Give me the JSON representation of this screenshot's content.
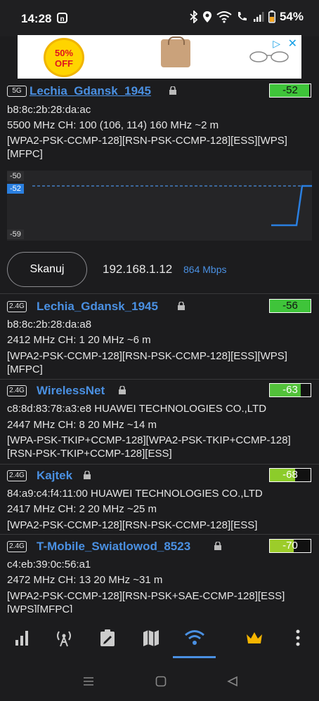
{
  "status_bar": {
    "time": "14:28",
    "battery": "54%"
  },
  "networks": [
    {
      "band": "5G",
      "ssid": "Lechia_Gdansk_1945",
      "signal": "-52",
      "signal_level": 0.96,
      "mac": "b8:8c:2b:28:da:ac",
      "details": "5500 MHz   CH: 100 (106, 114)   160 MHz   ~2 m",
      "security_1": "[WPA2-PSK-CCMP-128][RSN-PSK-CCMP-128][ESS][WPS]",
      "security_2": "[MFPC]"
    },
    {
      "band": "2.4G",
      "ssid": "Lechia_Gdansk_1945",
      "signal": "-56",
      "signal_level": 0.9,
      "mac": "b8:8c:2b:28:da:a8",
      "details": "2412 MHz   CH: 1   20 MHz   ~6 m",
      "security_1": "[WPA2-PSK-CCMP-128][RSN-PSK-CCMP-128][ESS][WPS]",
      "security_2": "[MFPC]"
    },
    {
      "band": "2.4G",
      "ssid": "WirelessNet",
      "signal": "-63",
      "signal_level": 0.75,
      "mac": "c8:8d:83:78:a3:e8 HUAWEI TECHNOLOGIES CO.,LTD",
      "details": "2447 MHz   CH: 8   20 MHz   ~14 m",
      "security_1": "[WPA-PSK-TKIP+CCMP-128][WPA2-PSK-TKIP+CCMP-128]",
      "security_2": "[RSN-PSK-TKIP+CCMP-128][ESS]"
    },
    {
      "band": "2.4G",
      "ssid": "Kajtek",
      "signal": "-68",
      "signal_level": 0.62,
      "mac": "84:a9:c4:f4:11:00 HUAWEI TECHNOLOGIES CO.,LTD",
      "details": "2417 MHz   CH: 2   20 MHz   ~25 m",
      "security_1": "[WPA2-PSK-CCMP-128][RSN-PSK-CCMP-128][ESS]",
      "security_2": ""
    },
    {
      "band": "2.4G",
      "ssid": "T-Mobile_Swiatlowod_8523",
      "signal": "-70",
      "signal_level": 0.58,
      "mac": "c4:eb:39:0c:56:a1",
      "details": "2472 MHz   CH: 13   20 MHz   ~31 m",
      "security_1": "[WPA2-PSK-CCMP-128][RSN-PSK+SAE-CCMP-128][ESS]",
      "security_2": "[WPS][MFPC]"
    }
  ],
  "graph": {
    "tick_top": "-50",
    "tick_current": "-52",
    "tick_bottom": "-59"
  },
  "scan": {
    "button": "Skanuj",
    "ip": "192.168.1.12",
    "speed": "864 Mbps"
  },
  "ad": {
    "badge_pct": "50%",
    "badge_off": "OFF"
  },
  "colors": {
    "accent": "#4a90e2",
    "signal_green": "#3fc43a",
    "background": "#1c1c1e"
  }
}
